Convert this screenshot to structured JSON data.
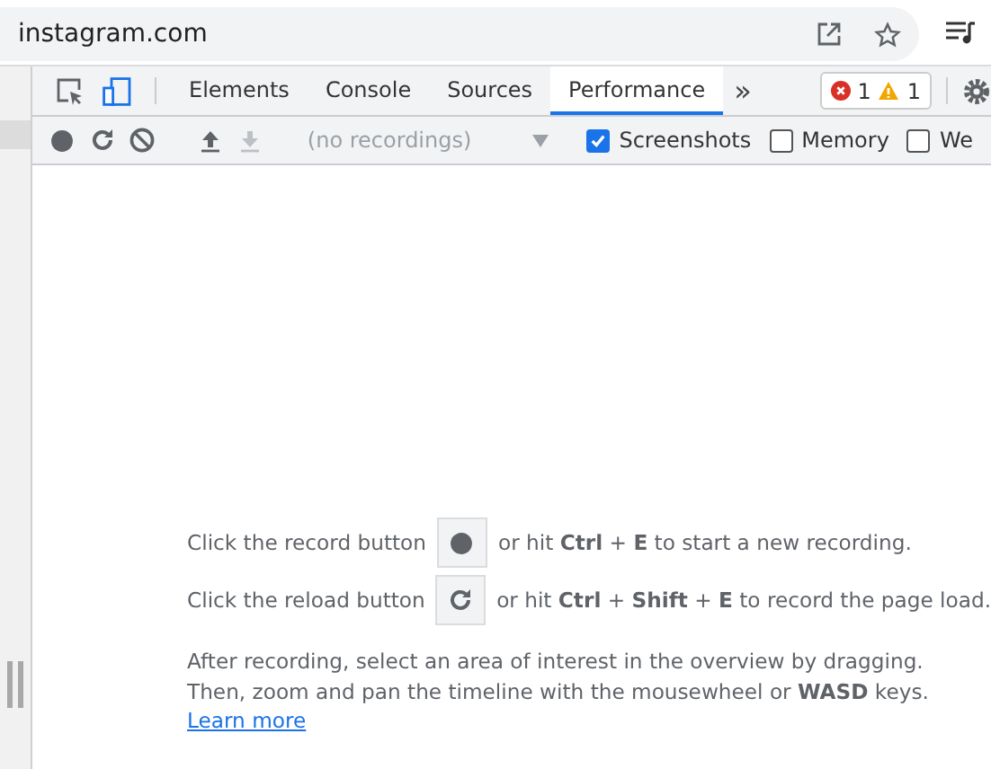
{
  "address_bar": {
    "url": "instagram.com"
  },
  "devtools": {
    "tabs": [
      {
        "label": "Elements",
        "selected": false
      },
      {
        "label": "Console",
        "selected": false
      },
      {
        "label": "Sources",
        "selected": false
      },
      {
        "label": "Performance",
        "selected": true
      }
    ],
    "more_tabs": "»",
    "issues": {
      "errors": "1",
      "warnings": "1"
    },
    "toolbar": {
      "recordings": {
        "placeholder": "(no recordings)"
      },
      "options": [
        {
          "label": "Screenshots",
          "checked": true
        },
        {
          "label": "Memory",
          "checked": false
        },
        {
          "label": "We",
          "checked": false
        }
      ]
    },
    "instructions": [
      {
        "kind": "record",
        "before": "Click the record button",
        "after": "or hit **Ctrl** + **E** to start a new recording."
      },
      {
        "kind": "reload",
        "before": "Click the reload button",
        "after": "or hit **Ctrl** + **Shift** + **E** to record the page load."
      }
    ],
    "hint": "After recording, select an area of interest in the overview by dragging. Then, zoom and pan the timeline with the mousewheel or **WASD** keys.",
    "learn_more": "Learn more"
  }
}
